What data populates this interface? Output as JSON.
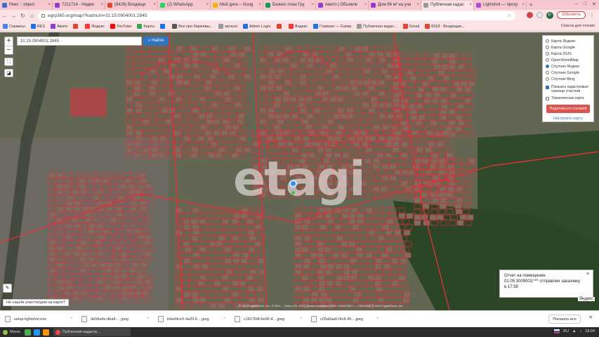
{
  "tabs": [
    {
      "label": "Реес :: object",
      "color": "#3b6cd4",
      "active": false
    },
    {
      "label": "7211714 - Недви",
      "color": "#8c3fd1",
      "active": false
    },
    {
      "label": "(8426) Входящи",
      "color": "#e0452f",
      "active": false
    },
    {
      "label": "(2) WhatsApp",
      "color": "#25d366",
      "active": false
    },
    {
      "label": "Мой диск – Goog",
      "color": "#f4b400",
      "active": false
    },
    {
      "label": "Бизнес план Гру",
      "color": "#0f9d58",
      "active": false
    },
    {
      "label": "Авито | Объявле",
      "color": "#8c3fd1",
      "active": false
    },
    {
      "label": "Дом 96 м² на уча",
      "color": "#8c3fd1",
      "active": false
    },
    {
      "label": "Публичная кадас",
      "color": "#9a9a9a",
      "active": true
    },
    {
      "label": "Lightshot — прогр",
      "color": "#b04bd6",
      "active": false
    }
  ],
  "address": {
    "url": "egrp365.org/map/?kadnum=31:15:0904001:2845",
    "update_label": "Обновить",
    "avatar": "P"
  },
  "bookmarks": [
    {
      "label": "Сервисы",
      "color": "#4285f4"
    },
    {
      "label": "RES",
      "color": "#1a73e8"
    },
    {
      "label": "Авито",
      "color": "#8c3fd1"
    },
    {
      "label": "",
      "color": "#e0452f"
    },
    {
      "label": "Яндекс",
      "color": "#ff3333"
    },
    {
      "label": "YouTube",
      "color": "#ff0000"
    },
    {
      "label": "Карты",
      "color": "#34a853"
    },
    {
      "label": "",
      "color": "#1a73e8"
    },
    {
      "label": "Все про биржевы...",
      "color": "#555555"
    },
    {
      "label": "мульти",
      "color": "#999999"
    },
    {
      "label": "Admin Login",
      "color": "#1a73e8"
    },
    {
      "label": "",
      "color": "#e0452f"
    },
    {
      "label": "Яндекс",
      "color": "#ff3333"
    },
    {
      "label": "Главная — Сапка",
      "color": "#1a73e8"
    },
    {
      "label": "Публичная кадас...",
      "color": "#9a9a9a"
    },
    {
      "label": "Gmail",
      "color": "#ea4335"
    },
    {
      "label": "8318 · Входящие...",
      "color": "#e0452f"
    }
  ],
  "bookmarks_right": "Список для чтения",
  "map": {
    "search_value": "31:15:0904001:2845",
    "find_label": "Найти",
    "zoom_in": "+",
    "zoom_out": "−",
    "watermark": "etagi",
    "layers": [
      {
        "label": "Карта Яндекс",
        "selected": false
      },
      {
        "label": "Карта Google",
        "selected": false
      },
      {
        "label": "Карта 2GIS",
        "selected": false
      },
      {
        "label": "OpenStreetMap",
        "selected": false
      },
      {
        "label": "Спутник Яндекс",
        "selected": true
      },
      {
        "label": "Спутник Google",
        "selected": false
      },
      {
        "label": "Спутник Bing",
        "selected": false
      }
    ],
    "checkbox_cadastral": "Показать кадастровые границы участков",
    "checkbox_thematic": "Тематическая карта",
    "share_label": "Поделиться ссылкой",
    "map_settings": "Настроить карту",
    "toast_line1": "Отчет на помещение",
    "toast_line2": "01:05:3009003:*** отправлен заказчику",
    "toast_line3": "в 17:58",
    "toast_close": "×",
    "not_found": "Не нашли участок/дом на карте?",
    "attribution": "© 2013 DigitalGlobe, Inc., © 2021 ... Airbus DS, 2021, распространение ООО «СКАНЭКС» — СКАНЭКС © 2010 DigitalGlobe, Inc.",
    "provider": "Яндекс"
  },
  "downloads": [
    {
      "label": "setup-lightshot.exe"
    },
    {
      "label": "de58a4e-dba9-....jpeg"
    },
    {
      "label": "b4a44ce0-4a20-6....jpeg"
    },
    {
      "label": "c181764f-6e96-4....jpeg"
    },
    {
      "label": "c03a0aa6-f4c8-40....jpeg"
    }
  ],
  "downloads_show_all": "Показать все",
  "taskbar": {
    "start": "Меню",
    "task": "Публичная кадастр...",
    "time": "18:04",
    "lang": "RU"
  }
}
